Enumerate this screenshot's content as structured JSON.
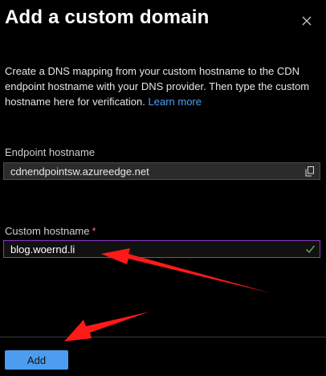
{
  "panel": {
    "title": "Add a custom domain",
    "description": "Create a DNS mapping from your custom hostname to the CDN endpoint hostname with your DNS provider. Then type the custom hostname here for verification.",
    "learn_more": "Learn more"
  },
  "endpoint": {
    "label": "Endpoint hostname",
    "value": "cdnendpointsw.azureedge.net"
  },
  "custom": {
    "label": "Custom hostname",
    "required_mark": "*",
    "value": "blog.woernd.li"
  },
  "footer": {
    "add_label": "Add"
  },
  "colors": {
    "accent": "#4c9df0",
    "link": "#4ca1f5",
    "input_border": "#8a38c7",
    "annotation_arrow": "#ff1a1a"
  },
  "icons": [
    "close-icon",
    "copy-icon",
    "checkmark-icon"
  ]
}
